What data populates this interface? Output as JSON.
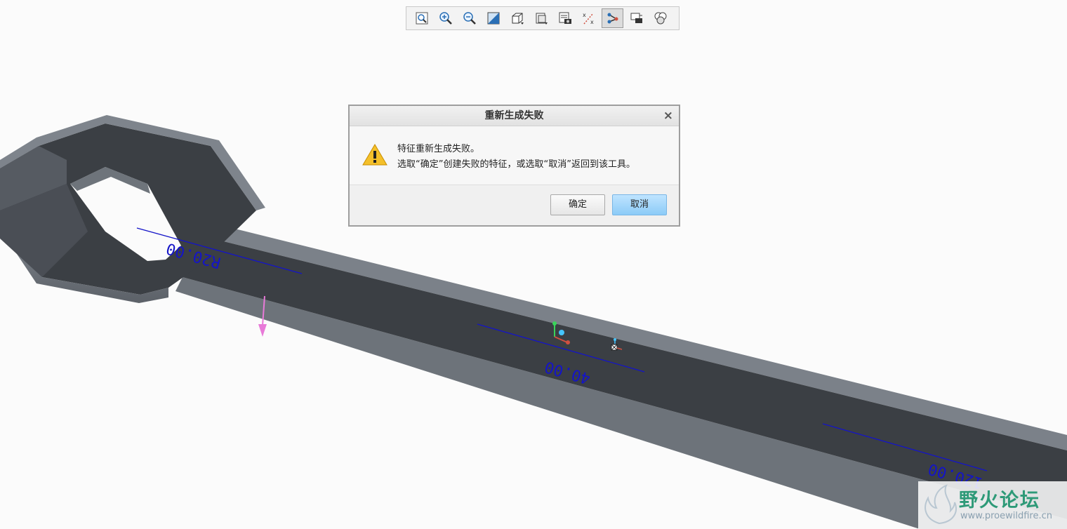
{
  "toolbar": {
    "buttons": [
      {
        "icon": "refit-icon",
        "active": false
      },
      {
        "icon": "zoom-in-icon",
        "active": false
      },
      {
        "icon": "zoom-out-icon",
        "active": false
      },
      {
        "icon": "repaint-icon",
        "active": false
      },
      {
        "icon": "display-style-icon",
        "active": false
      },
      {
        "icon": "saved-orientation-icon",
        "active": false
      },
      {
        "icon": "view-manager-icon",
        "active": false
      },
      {
        "icon": "datum-display-icon",
        "active": false
      },
      {
        "icon": "annotation-display-icon",
        "active": true
      },
      {
        "icon": "spin-center-icon",
        "active": false
      },
      {
        "icon": "appearance-gallery-icon",
        "active": false
      }
    ]
  },
  "dialog": {
    "title": "重新生成失败",
    "close_symbol": "×",
    "message_line1": "特征重新生成失败。",
    "message_line2": "选取“确定”创建失败的特征，或选取“取消”返回到该工具。",
    "ok_label": "确定",
    "cancel_label": "取消",
    "icon": "warning-icon"
  },
  "model": {
    "dimension_labels": [
      "R20.00",
      "40.00",
      "120.00"
    ]
  },
  "watermark": {
    "title": "野火论坛",
    "url": "www.proewildfire.cn"
  },
  "colors": {
    "background": "#fbfbfb",
    "part_top": "#3b3f44",
    "part_side": "#7a8088",
    "dimension": "#1414c8",
    "arrow": "#e87ad8",
    "cancel_button": "#8ccbf7"
  }
}
